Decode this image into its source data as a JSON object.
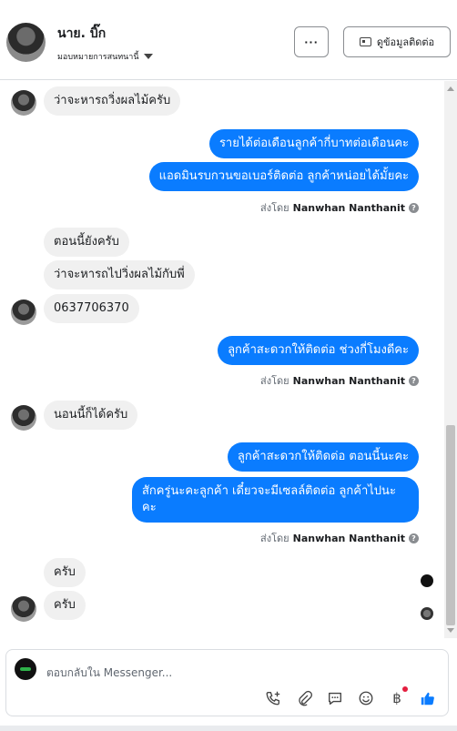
{
  "header": {
    "contact_name": "นาย. บิ๊ก",
    "assign_label": "มอบหมายการสนทนานี้",
    "more_label": "···",
    "info_button_label": "ดูข้อมูลติดต่อ"
  },
  "messages": {
    "m1": "ว่าจะหารถวิ่งผลไม้ครับ",
    "m2": "รายได้ต่อเดือนลูกค้ากี่บาทต่อเดือนคะ",
    "m3": "แอดมินรบกวนขอเบอร์ติดต่อ ลูกค้าหน่อยได้มั้ยคะ",
    "m4": "ตอนนี้ยังครับ",
    "m5": "ว่าจะหารถไปวิ่งผลไม้กับพี่",
    "m6": "0637706370",
    "m7": "ลูกค้าสะดวกให้ติดต่อ ช่วงกี่โมงดีคะ",
    "m8": "นอนนี้ก็ได้ครับ",
    "m9": "ลูกค้าสะดวกให้ติดต่อ ตอนนี้นะคะ",
    "m10": "สักครู่นะคะลูกค้า เดี๋ยวจะมีเซลล์ติดต่อ ลูกค้าไปนะคะ",
    "m11": "ครับ",
    "m12": "ครับ"
  },
  "sent_by": {
    "prefix": "ส่งโดย",
    "name": "Nanwhan Nanthanit",
    "help": "?"
  },
  "composer": {
    "placeholder": "ตอบกลับใน Messenger..."
  },
  "tool_icons": [
    "phone-add-icon",
    "paperclip-icon",
    "saved-reply-icon",
    "emoji-icon",
    "baht-icon",
    "like-icon"
  ],
  "colors": {
    "outgoing_bubble": "#0a7cff",
    "incoming_bubble": "#f0f0f0",
    "like": "#0a7cff",
    "badge": "#e41e3f"
  }
}
